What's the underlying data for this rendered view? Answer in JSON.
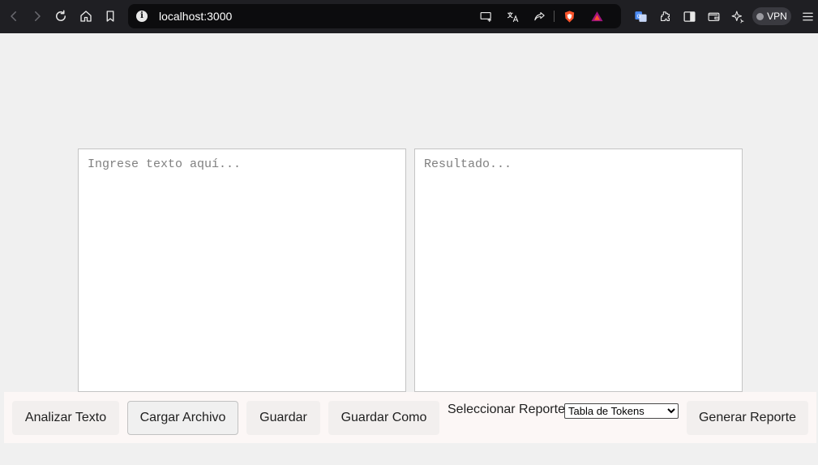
{
  "browser": {
    "url": "localhost:3000",
    "info_glyph": "i",
    "vpn_label": "VPN",
    "icons": [
      "back-icon",
      "forward-icon",
      "reload-icon",
      "home-icon",
      "bookmark-icon",
      "cast-icon",
      "translate-icon",
      "share-icon",
      "brave-shield-icon",
      "brave-rewards-icon",
      "translate-extension-icon",
      "extensions-icon",
      "sidebar-icon",
      "wallet-icon",
      "leo-ai-icon",
      "menu-icon"
    ]
  },
  "editor": {
    "input_placeholder": "Ingrese texto aquí...",
    "output_placeholder": "Resultado..."
  },
  "toolbar": {
    "analyze_label": "Analizar Texto",
    "load_label": "Cargar Archivo",
    "save_label": "Guardar",
    "save_as_label": "Guardar Como",
    "report_label": "Seleccionar Reporte:",
    "report_selected": "Tabla de Tokens",
    "generate_label": "Generar Reporte"
  },
  "colors": {
    "page_bg": "#f0f0f0",
    "chrome_bg": "#1f1f23",
    "toolbar_bg": "#fcf7f6",
    "brave_orange": "#fb542b",
    "rewards_purple": "#a0147d"
  }
}
